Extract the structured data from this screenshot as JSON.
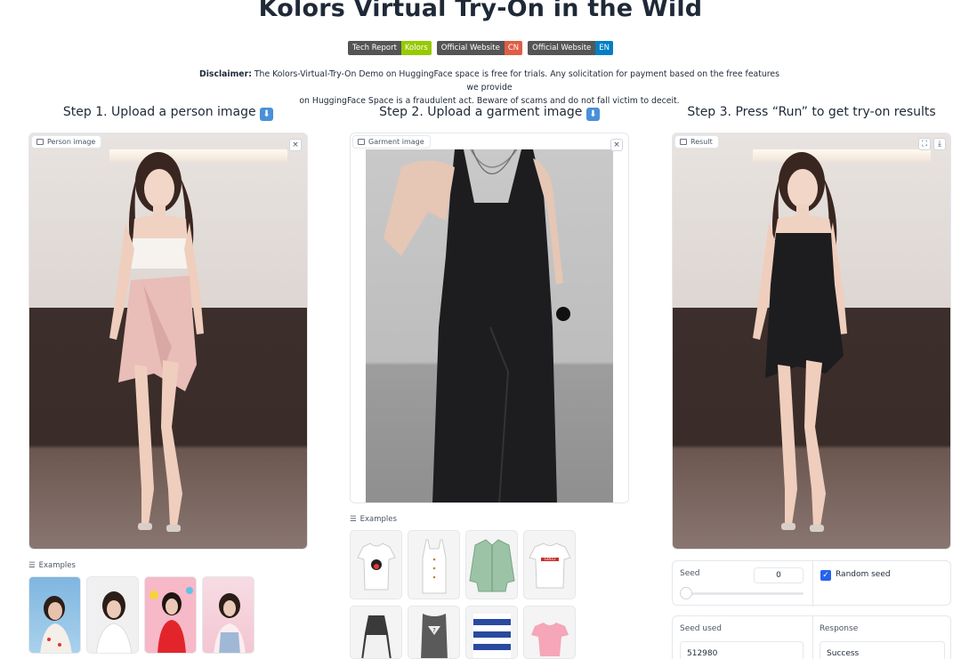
{
  "header": {
    "title": "Kolors Virtual Try-On in the Wild",
    "badges": [
      {
        "left": "Tech Report",
        "right": "Kolors",
        "color": "#97ca00"
      },
      {
        "left": "Official Website",
        "right": "CN",
        "color": "#e05d44"
      },
      {
        "left": "Official Website",
        "right": "EN",
        "color": "#007ec6"
      }
    ],
    "disclaimer_label": "Disclaimer:",
    "disclaimer_line1": " The Kolors-Virtual-Try-On Demo on HuggingFace space is free for trials. Any solicitation for payment based on the free features we provide",
    "disclaimer_line2": "on HuggingFace Space is a fraudulent act. Beware of scams and do not fall victim to deceit."
  },
  "steps": {
    "step1": "Step 1. Upload a person image",
    "step2": "Step 2. Upload a garment image",
    "step3": "Step 3. Press “Run” to get try-on results"
  },
  "panels": {
    "person_label": "Person image",
    "garment_label": "Garment image",
    "result_label": "Result",
    "close_glyph": "×",
    "fullscreen_glyph": "⛶",
    "download_glyph": "⤓"
  },
  "examples": {
    "person_label": "Examples",
    "garment_label": "Examples"
  },
  "garment_examples_text": {
    "tee_logo": "GUCCI",
    "tank_logo": "?"
  },
  "controls": {
    "seed_label": "Seed",
    "seed_value": "0",
    "random_seed_label": "Random seed",
    "random_seed_checked": true,
    "seed_used_label": "Seed used",
    "seed_used_value": "512980",
    "response_label": "Response",
    "response_value": "Success"
  },
  "icons": [
    "image-icon",
    "close-icon",
    "fullscreen-icon",
    "download-icon",
    "list-icon",
    "down-arrow-emoji-icon",
    "check-icon"
  ]
}
